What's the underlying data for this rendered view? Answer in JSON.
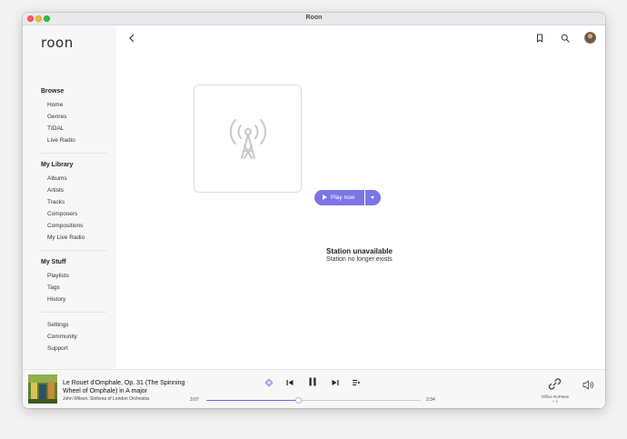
{
  "window": {
    "title": "Roon"
  },
  "sidebar": {
    "logo": "roon",
    "sections": [
      {
        "title": "Browse",
        "items": [
          "Home",
          "Genres",
          "TIDAL",
          "Live Radio"
        ]
      },
      {
        "title": "My Library",
        "items": [
          "Albums",
          "Artists",
          "Tracks",
          "Composers",
          "Compositions",
          "My Live Radio"
        ]
      },
      {
        "title": "My Stuff",
        "items": [
          "Playlists",
          "Tags",
          "History"
        ]
      }
    ],
    "footer_items": [
      "Settings",
      "Community",
      "Support"
    ]
  },
  "toolbar": {
    "icons": [
      "back-chevron-icon",
      "bookmark-icon",
      "search-icon",
      "avatar"
    ]
  },
  "station": {
    "icon": "radio-tower-icon",
    "play_label": "Play now",
    "status_title": "Station unavailable",
    "status_subtitle": "Station no longer exists"
  },
  "player": {
    "track_title": "Le Rouet d'Omphale, Op. 31 (The Spinning Wheel of Omphale) in A major",
    "track_artist": "John Wilson, Sinfonia of London Orchestra",
    "elapsed": "3:07",
    "remaining": "2:34",
    "progress": 0.43,
    "zone_name": "Office RoPieee",
    "zone_count": "+ 1",
    "accent": "#7b76e6"
  }
}
